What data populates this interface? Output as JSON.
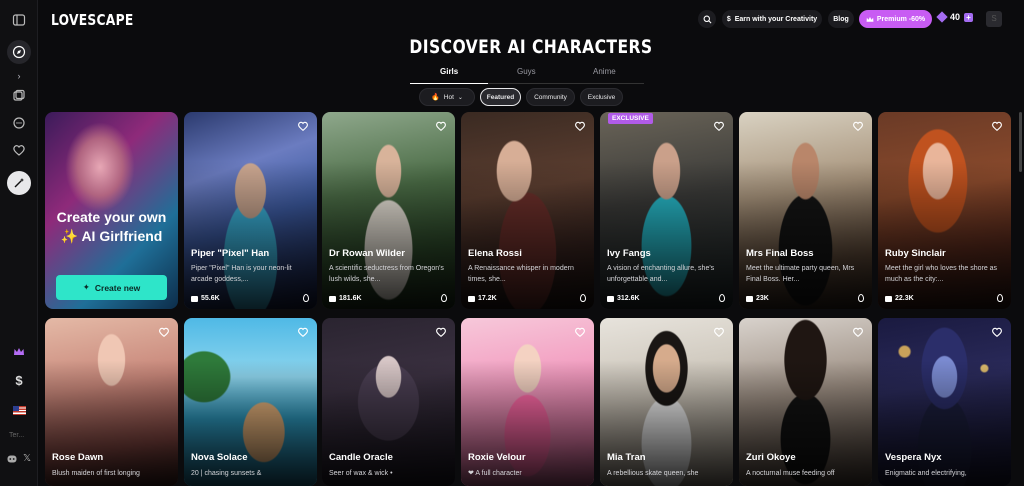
{
  "brand": "LOVESCAPE",
  "header": {
    "earn_label": "Earn with your Creativity",
    "blog_label": "Blog",
    "premium_label": "Premium -60%",
    "gems": "40",
    "avatar_initial": "S"
  },
  "sidebar": {
    "small_label": "Ter..."
  },
  "page_title": "DISCOVER AI CHARACTERS",
  "tabs": [
    {
      "label": "Girls",
      "active": true
    },
    {
      "label": "Guys",
      "active": false
    },
    {
      "label": "Anime",
      "active": false
    }
  ],
  "filters": [
    {
      "label": "Hot",
      "selected": false
    },
    {
      "label": "Featured",
      "selected": true
    },
    {
      "label": "Community",
      "selected": false
    },
    {
      "label": "Exclusive",
      "selected": false
    }
  ],
  "create_card": {
    "title": "Create your own ✨ AI Girlfriend",
    "button": "Create new"
  },
  "characters_row1": [
    {
      "name": "Piper \"Pixel\" Han",
      "desc": "Piper \"Pixel\" Han is your neon-lit arcade goddess,...",
      "count": "55.6K"
    },
    {
      "name": "Dr Rowan Wilder",
      "desc": "A scientific seductress from Oregon's lush wilds, she...",
      "count": "181.6K"
    },
    {
      "name": "Elena Rossi",
      "desc": "A Renaissance whisper in modern times, she...",
      "count": "17.2K"
    },
    {
      "name": "Ivy Fangs",
      "desc": "A vision of enchanting allure, she's unforgettable and...",
      "count": "312.6K",
      "badge": "EXCLUSIVE"
    },
    {
      "name": "Mrs Final Boss",
      "desc": "Meet the ultimate party queen, Mrs Final Boss. Her...",
      "count": "23K"
    },
    {
      "name": "Ruby Sinclair",
      "desc": "Meet the girl who loves the shore as much as the city:...",
      "count": "22.3K"
    }
  ],
  "characters_row2": [
    {
      "name": "Rose Dawn",
      "desc": "Blush maiden of first longing"
    },
    {
      "name": "Nova Solace",
      "desc": "20 | chasing sunsets &"
    },
    {
      "name": "Candle Oracle",
      "desc": "Seer of wax & wick •"
    },
    {
      "name": "Roxie Velour",
      "desc": "❤ A full character"
    },
    {
      "name": "Mia Tran",
      "desc": "A rebellious skate queen, she"
    },
    {
      "name": "Zuri Okoye",
      "desc": "A nocturnal muse feeding off"
    },
    {
      "name": "Vespera Nyx",
      "desc": "Enigmatic and electrifying,"
    }
  ]
}
